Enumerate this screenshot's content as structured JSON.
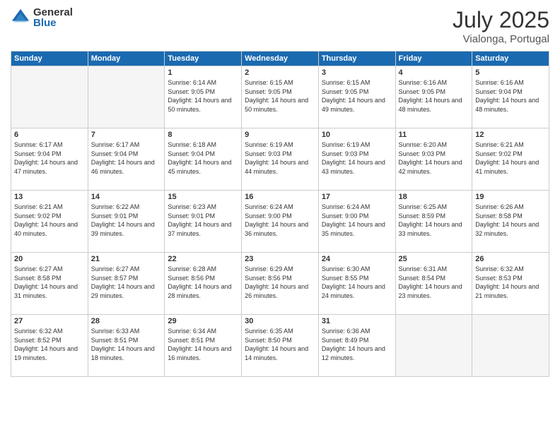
{
  "logo": {
    "general": "General",
    "blue": "Blue"
  },
  "header": {
    "month": "July 2025",
    "location": "Vialonga, Portugal"
  },
  "days_of_week": [
    "Sunday",
    "Monday",
    "Tuesday",
    "Wednesday",
    "Thursday",
    "Friday",
    "Saturday"
  ],
  "weeks": [
    [
      {
        "day": "",
        "empty": true
      },
      {
        "day": "",
        "empty": true
      },
      {
        "day": "1",
        "sunrise": "6:14 AM",
        "sunset": "9:05 PM",
        "daylight": "14 hours and 50 minutes."
      },
      {
        "day": "2",
        "sunrise": "6:15 AM",
        "sunset": "9:05 PM",
        "daylight": "14 hours and 50 minutes."
      },
      {
        "day": "3",
        "sunrise": "6:15 AM",
        "sunset": "9:05 PM",
        "daylight": "14 hours and 49 minutes."
      },
      {
        "day": "4",
        "sunrise": "6:16 AM",
        "sunset": "9:05 PM",
        "daylight": "14 hours and 48 minutes."
      },
      {
        "day": "5",
        "sunrise": "6:16 AM",
        "sunset": "9:04 PM",
        "daylight": "14 hours and 48 minutes."
      }
    ],
    [
      {
        "day": "6",
        "sunrise": "6:17 AM",
        "sunset": "9:04 PM",
        "daylight": "14 hours and 47 minutes."
      },
      {
        "day": "7",
        "sunrise": "6:17 AM",
        "sunset": "9:04 PM",
        "daylight": "14 hours and 46 minutes."
      },
      {
        "day": "8",
        "sunrise": "6:18 AM",
        "sunset": "9:04 PM",
        "daylight": "14 hours and 45 minutes."
      },
      {
        "day": "9",
        "sunrise": "6:19 AM",
        "sunset": "9:03 PM",
        "daylight": "14 hours and 44 minutes."
      },
      {
        "day": "10",
        "sunrise": "6:19 AM",
        "sunset": "9:03 PM",
        "daylight": "14 hours and 43 minutes."
      },
      {
        "day": "11",
        "sunrise": "6:20 AM",
        "sunset": "9:03 PM",
        "daylight": "14 hours and 42 minutes."
      },
      {
        "day": "12",
        "sunrise": "6:21 AM",
        "sunset": "9:02 PM",
        "daylight": "14 hours and 41 minutes."
      }
    ],
    [
      {
        "day": "13",
        "sunrise": "6:21 AM",
        "sunset": "9:02 PM",
        "daylight": "14 hours and 40 minutes."
      },
      {
        "day": "14",
        "sunrise": "6:22 AM",
        "sunset": "9:01 PM",
        "daylight": "14 hours and 39 minutes."
      },
      {
        "day": "15",
        "sunrise": "6:23 AM",
        "sunset": "9:01 PM",
        "daylight": "14 hours and 37 minutes."
      },
      {
        "day": "16",
        "sunrise": "6:24 AM",
        "sunset": "9:00 PM",
        "daylight": "14 hours and 36 minutes."
      },
      {
        "day": "17",
        "sunrise": "6:24 AM",
        "sunset": "9:00 PM",
        "daylight": "14 hours and 35 minutes."
      },
      {
        "day": "18",
        "sunrise": "6:25 AM",
        "sunset": "8:59 PM",
        "daylight": "14 hours and 33 minutes."
      },
      {
        "day": "19",
        "sunrise": "6:26 AM",
        "sunset": "8:58 PM",
        "daylight": "14 hours and 32 minutes."
      }
    ],
    [
      {
        "day": "20",
        "sunrise": "6:27 AM",
        "sunset": "8:58 PM",
        "daylight": "14 hours and 31 minutes."
      },
      {
        "day": "21",
        "sunrise": "6:27 AM",
        "sunset": "8:57 PM",
        "daylight": "14 hours and 29 minutes."
      },
      {
        "day": "22",
        "sunrise": "6:28 AM",
        "sunset": "8:56 PM",
        "daylight": "14 hours and 28 minutes."
      },
      {
        "day": "23",
        "sunrise": "6:29 AM",
        "sunset": "8:56 PM",
        "daylight": "14 hours and 26 minutes."
      },
      {
        "day": "24",
        "sunrise": "6:30 AM",
        "sunset": "8:55 PM",
        "daylight": "14 hours and 24 minutes."
      },
      {
        "day": "25",
        "sunrise": "6:31 AM",
        "sunset": "8:54 PM",
        "daylight": "14 hours and 23 minutes."
      },
      {
        "day": "26",
        "sunrise": "6:32 AM",
        "sunset": "8:53 PM",
        "daylight": "14 hours and 21 minutes."
      }
    ],
    [
      {
        "day": "27",
        "sunrise": "6:32 AM",
        "sunset": "8:52 PM",
        "daylight": "14 hours and 19 minutes."
      },
      {
        "day": "28",
        "sunrise": "6:33 AM",
        "sunset": "8:51 PM",
        "daylight": "14 hours and 18 minutes."
      },
      {
        "day": "29",
        "sunrise": "6:34 AM",
        "sunset": "8:51 PM",
        "daylight": "14 hours and 16 minutes."
      },
      {
        "day": "30",
        "sunrise": "6:35 AM",
        "sunset": "8:50 PM",
        "daylight": "14 hours and 14 minutes."
      },
      {
        "day": "31",
        "sunrise": "6:36 AM",
        "sunset": "8:49 PM",
        "daylight": "14 hours and 12 minutes."
      },
      {
        "day": "",
        "empty": true
      },
      {
        "day": "",
        "empty": true
      }
    ]
  ],
  "labels": {
    "sunrise": "Sunrise:",
    "sunset": "Sunset:",
    "daylight": "Daylight:"
  }
}
